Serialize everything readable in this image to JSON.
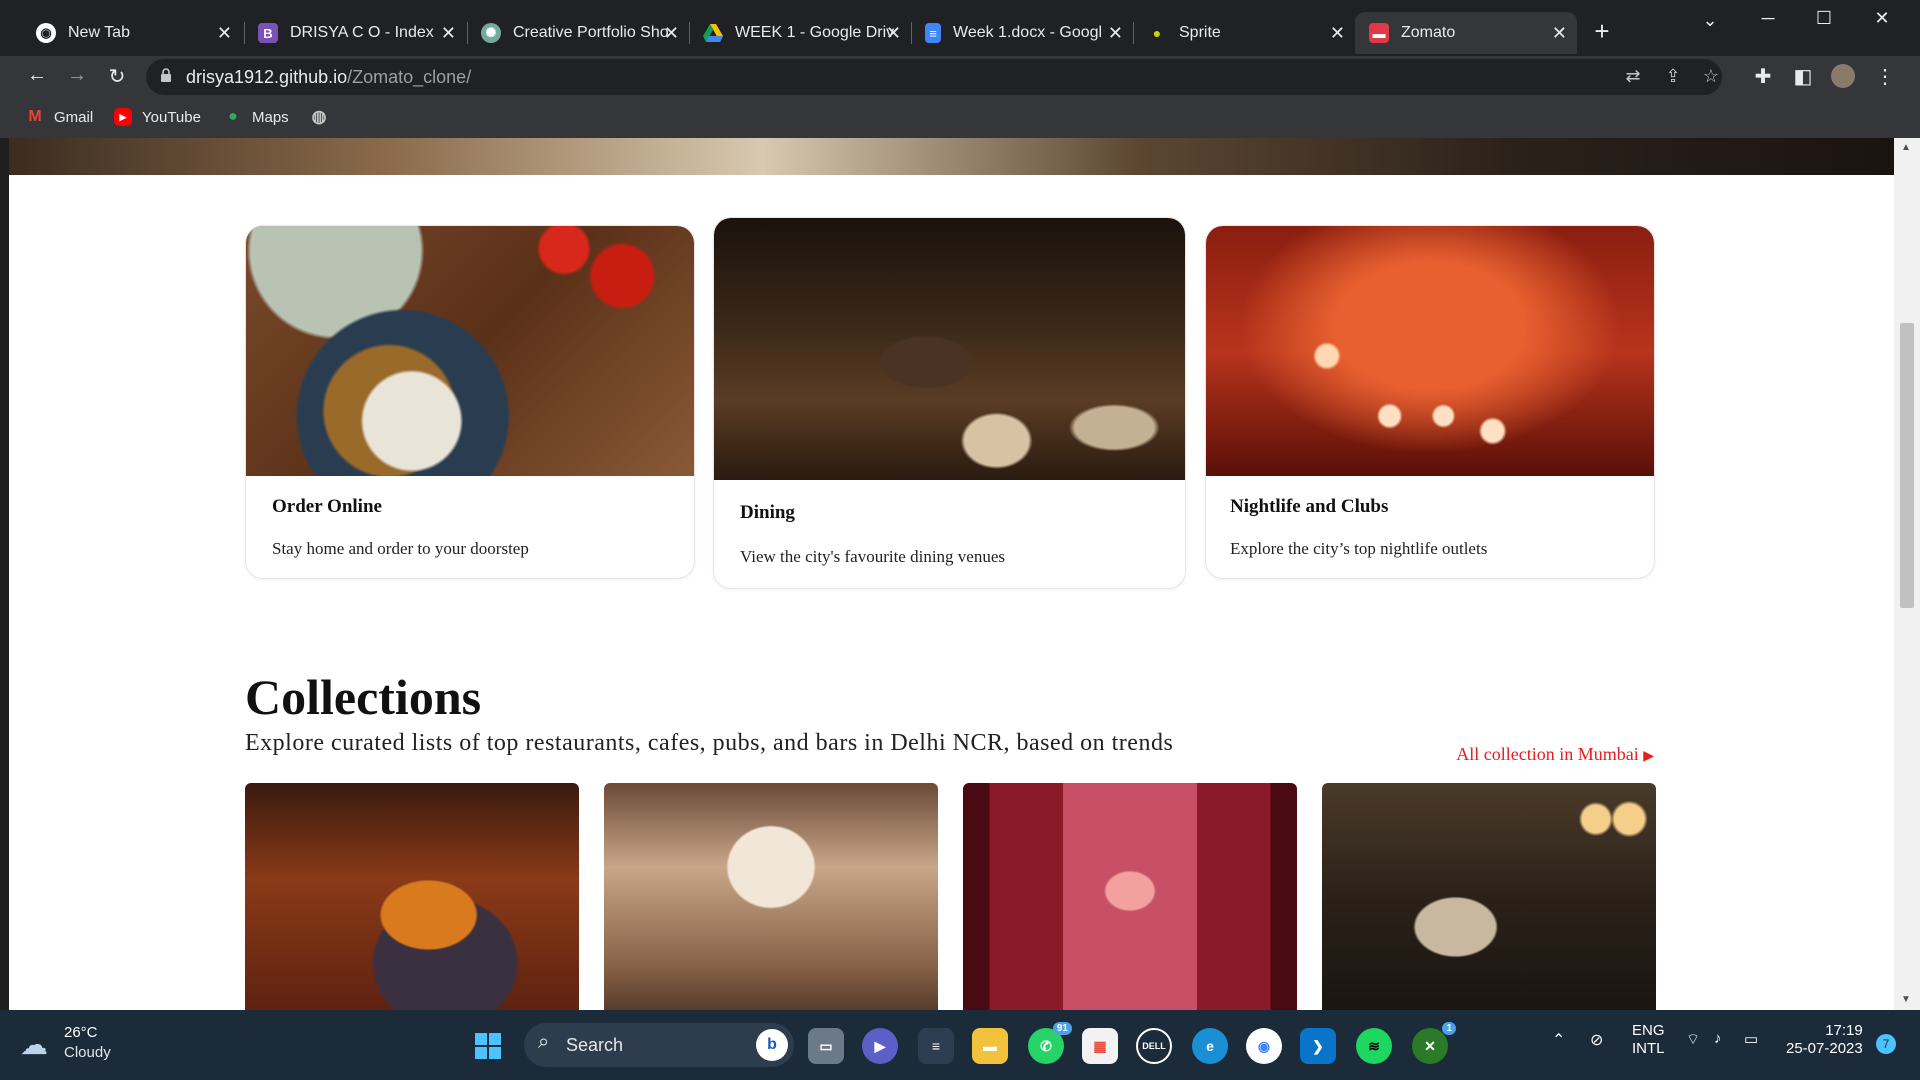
{
  "browser": {
    "tabs": [
      {
        "title": "New Tab",
        "icon": "chrome-icon"
      },
      {
        "title": "DRISYA C O - Index",
        "icon": "bootstrap-icon"
      },
      {
        "title": "Creative Portfolio Sho",
        "icon": "chatgpt-icon"
      },
      {
        "title": "WEEK 1 - Google Driv",
        "icon": "google-drive-icon"
      },
      {
        "title": "Week 1.docx - Googl",
        "icon": "google-docs-icon"
      },
      {
        "title": "Sprite",
        "icon": "sprite-icon"
      },
      {
        "title": "Zomato",
        "icon": "zomato-icon"
      }
    ],
    "new_tab_glyph": "+",
    "url_host": "drisya1912.github.io",
    "url_path": "/Zomato_clone/",
    "bookmarks": [
      {
        "label": "Gmail",
        "icon": "gmail-icon"
      },
      {
        "label": "YouTube",
        "icon": "youtube-icon"
      },
      {
        "label": "Maps",
        "icon": "maps-icon"
      }
    ]
  },
  "page": {
    "cards": [
      {
        "title": "Order Online",
        "desc": "Stay home and order to your doorstep"
      },
      {
        "title": "Dining",
        "desc": "View the city's favourite dining venues"
      },
      {
        "title": "Nightlife and Clubs",
        "desc": "Explore the city’s top nightlife outlets"
      }
    ],
    "collections": {
      "title": "Collections",
      "subtitle": "Explore curated lists of top restaurants, cafes, pubs, and bars in Delhi NCR, based on trends",
      "link": "All collection in Mumbai"
    }
  },
  "taskbar": {
    "weather_temp": "26°C",
    "weather_cond": "Cloudy",
    "search_label": "Search",
    "whatsapp_badge": "91",
    "xbox_badge": "1",
    "lang_1": "ENG",
    "lang_2": "INTL",
    "time": "17:19",
    "date": "25-07-2023",
    "notif_count": "7"
  },
  "colors": {
    "accent_red": "#e81d1d",
    "zomato_red": "#e23744",
    "chrome_dark": "#202124"
  }
}
